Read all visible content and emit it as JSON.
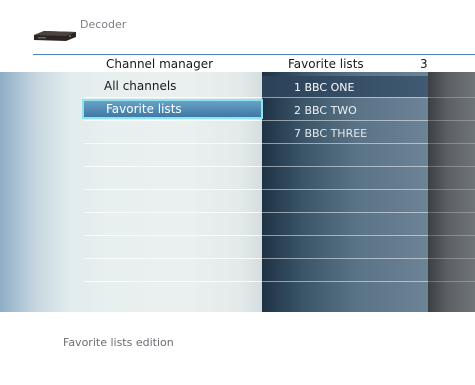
{
  "header": {
    "breadcrumb": "Decoder",
    "title": "Channel manager",
    "right_label": "Favorite lists",
    "count": "3"
  },
  "left_menu": {
    "items": [
      {
        "label": "All channels",
        "selected": false
      },
      {
        "label": "Favorite lists",
        "selected": true
      }
    ]
  },
  "right_list": {
    "items": [
      "1 BBC ONE",
      "2 BBC TWO",
      "7 BBC THREE"
    ]
  },
  "footer": {
    "help_text": "Favorite lists edition"
  },
  "colors": {
    "accent": "#4e87b6",
    "selection": "#3e79a5",
    "selection_border": "#8fe3ee"
  },
  "icons": {
    "device": "decoder-box-icon"
  }
}
